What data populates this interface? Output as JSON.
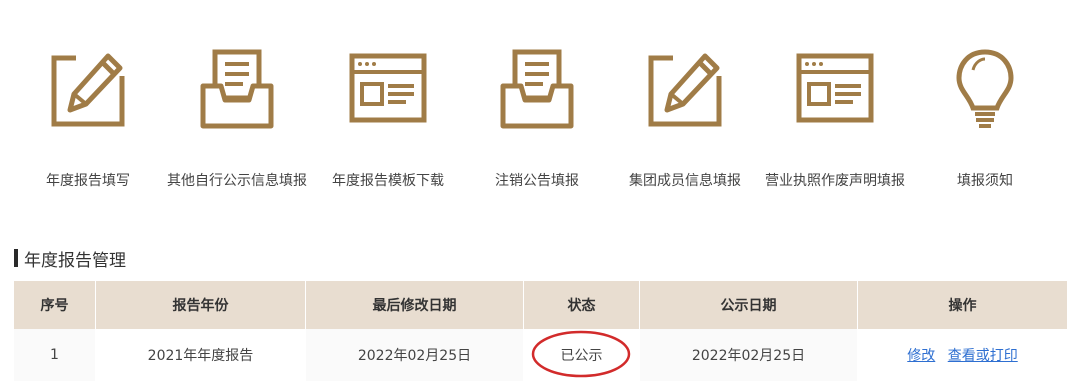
{
  "colors": {
    "icon": "#a07c47",
    "header_bg": "#e8ddd0",
    "link": "#2e6fd1",
    "highlight": "#d22b2b"
  },
  "icons": [
    {
      "label": "年度报告填写",
      "icon": "edit-pencil-icon"
    },
    {
      "label": "其他自行公示信息填报",
      "icon": "inbox-tray-icon"
    },
    {
      "label": "年度报告模板下载",
      "icon": "browser-window-icon"
    },
    {
      "label": "注销公告填报",
      "icon": "inbox-tray-icon"
    },
    {
      "label": "集团成员信息填报",
      "icon": "edit-pencil-icon"
    },
    {
      "label": "营业执照作废声明填报",
      "icon": "browser-window-icon"
    },
    {
      "label": "填报须知",
      "icon": "lightbulb-icon"
    }
  ],
  "section": {
    "title": "年度报告管理"
  },
  "table": {
    "headers": [
      "序号",
      "报告年份",
      "最后修改日期",
      "状态",
      "公示日期",
      "操作"
    ],
    "rows": [
      {
        "index": "1",
        "year": "2021年年度报告",
        "modified": "2022年02月25日",
        "status": "已公示",
        "published": "2022年02月25日",
        "actions": {
          "edit": "修改",
          "view": "查看或打印"
        }
      }
    ]
  }
}
